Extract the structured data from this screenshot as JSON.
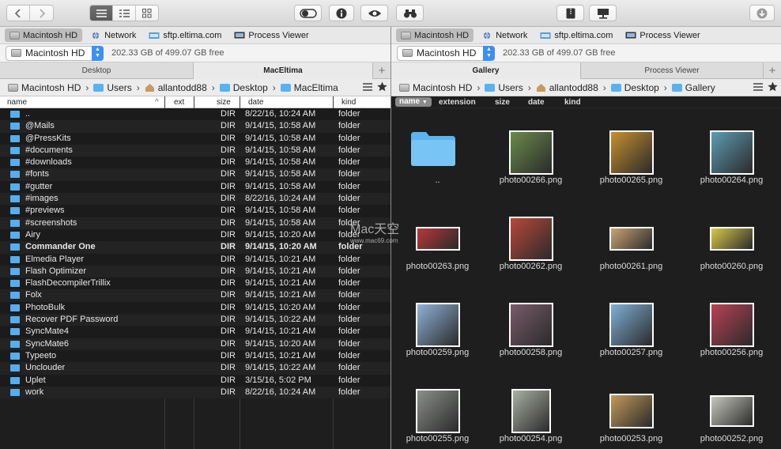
{
  "toolbar": {
    "icons": [
      "chevron-left-icon",
      "chevron-right-icon",
      "list-view-icon",
      "detail-view-icon",
      "grid-view-icon",
      "toggle-icon",
      "info-icon",
      "eye-icon",
      "binoculars-icon",
      "archive-icon",
      "network-drive-icon",
      "download-icon"
    ]
  },
  "left": {
    "drives": [
      "Macintosh HD",
      "Network",
      "sftp.eltima.com",
      "Process Viewer"
    ],
    "volume": "Macintosh HD",
    "free": "202.33 GB of 499.07 GB free",
    "tabs": [
      "Desktop",
      "MacEltima"
    ],
    "crumbs": [
      "Macintosh HD",
      "Users",
      "allantodd88",
      "Desktop",
      "MacEltima"
    ],
    "columns": {
      "name": "name",
      "ext": "ext",
      "size": "size",
      "date": "date",
      "kind": "kind"
    },
    "rows": [
      {
        "name": "..",
        "size": "DIR",
        "date": "8/22/16, 10:24 AM",
        "kind": "folder"
      },
      {
        "name": "@Mails",
        "size": "DIR",
        "date": "9/14/15, 10:58 AM",
        "kind": "folder"
      },
      {
        "name": "@PressKits",
        "size": "DIR",
        "date": "9/14/15, 10:58 AM",
        "kind": "folder"
      },
      {
        "name": "#documents",
        "size": "DIR",
        "date": "9/14/15, 10:58 AM",
        "kind": "folder"
      },
      {
        "name": "#downloads",
        "size": "DIR",
        "date": "9/14/15, 10:58 AM",
        "kind": "folder"
      },
      {
        "name": "#fonts",
        "size": "DIR",
        "date": "9/14/15, 10:58 AM",
        "kind": "folder"
      },
      {
        "name": "#gutter",
        "size": "DIR",
        "date": "9/14/15, 10:58 AM",
        "kind": "folder"
      },
      {
        "name": "#images",
        "size": "DIR",
        "date": "8/22/16, 10:24 AM",
        "kind": "folder"
      },
      {
        "name": "#previews",
        "size": "DIR",
        "date": "9/14/15, 10:58 AM",
        "kind": "folder"
      },
      {
        "name": "#screenshots",
        "size": "DIR",
        "date": "9/14/15, 10:58 AM",
        "kind": "folder"
      },
      {
        "name": "Airy",
        "size": "DIR",
        "date": "9/14/15, 10:20 AM",
        "kind": "folder"
      },
      {
        "name": "Commander One",
        "size": "DIR",
        "date": "9/14/15, 10:20 AM",
        "kind": "folder",
        "bold": true
      },
      {
        "name": "Elmedia Player",
        "size": "DIR",
        "date": "9/14/15, 10:21 AM",
        "kind": "folder"
      },
      {
        "name": "Flash Optimizer",
        "size": "DIR",
        "date": "9/14/15, 10:21 AM",
        "kind": "folder"
      },
      {
        "name": "FlashDecompilerTrillix",
        "size": "DIR",
        "date": "9/14/15, 10:21 AM",
        "kind": "folder"
      },
      {
        "name": "Folx",
        "size": "DIR",
        "date": "9/14/15, 10:21 AM",
        "kind": "folder"
      },
      {
        "name": "PhotoBulk",
        "size": "DIR",
        "date": "9/14/15, 10:20 AM",
        "kind": "folder"
      },
      {
        "name": "Recover PDF Password",
        "size": "DIR",
        "date": "9/14/15, 10:22 AM",
        "kind": "folder"
      },
      {
        "name": "SyncMate4",
        "size": "DIR",
        "date": "9/14/15, 10:21 AM",
        "kind": "folder"
      },
      {
        "name": "SyncMate6",
        "size": "DIR",
        "date": "9/14/15, 10:20 AM",
        "kind": "folder"
      },
      {
        "name": "Typeeto",
        "size": "DIR",
        "date": "9/14/15, 10:21 AM",
        "kind": "folder"
      },
      {
        "name": "Unclouder",
        "size": "DIR",
        "date": "9/14/15, 10:22 AM",
        "kind": "folder"
      },
      {
        "name": "Uplet",
        "size": "DIR",
        "date": "3/15/16, 5:02 PM",
        "kind": "folder"
      },
      {
        "name": "work",
        "size": "DIR",
        "date": "8/22/16, 10:24 AM",
        "kind": "folder"
      }
    ]
  },
  "right": {
    "drives": [
      "Macintosh HD",
      "Network",
      "sftp.eltima.com",
      "Process Viewer"
    ],
    "volume": "Macintosh HD",
    "free": "202.33 GB of 499.07 GB free",
    "tabs": [
      "Gallery",
      "Process Viewer"
    ],
    "crumbs": [
      "Macintosh HD",
      "Users",
      "allantodd88",
      "Desktop",
      "Gallery"
    ],
    "columns": {
      "name": "name",
      "extension": "extension",
      "size": "size",
      "date": "date",
      "kind": "kind"
    },
    "items": [
      {
        "name": "..",
        "color": "#5ab4ee"
      },
      {
        "name": "photo00266.png",
        "color": "#6a8b4a"
      },
      {
        "name": "photo00265.png",
        "color": "#c7902e"
      },
      {
        "name": "photo00264.png",
        "color": "#5d9db3"
      },
      {
        "name": "photo00263.png",
        "color": "#b8383a"
      },
      {
        "name": "photo00262.png",
        "color": "#b8483a"
      },
      {
        "name": "photo00261.png",
        "color": "#c9a474"
      },
      {
        "name": "photo00260.png",
        "color": "#d8c94a"
      },
      {
        "name": "photo00259.png",
        "color": "#8fb2d8"
      },
      {
        "name": "photo00258.png",
        "color": "#7a5b6a"
      },
      {
        "name": "photo00257.png",
        "color": "#7fb0d8"
      },
      {
        "name": "photo00256.png",
        "color": "#b84255"
      },
      {
        "name": "photo00255.png",
        "color": "#8a8f8a"
      },
      {
        "name": "photo00254.png",
        "color": "#a8b0a2"
      },
      {
        "name": "photo00253.png",
        "color": "#c39a5a"
      },
      {
        "name": "photo00252.png",
        "color": "#c8c8c0"
      }
    ]
  },
  "watermark": {
    "text": "Mac天空",
    "sub": "www.mac69.com"
  }
}
